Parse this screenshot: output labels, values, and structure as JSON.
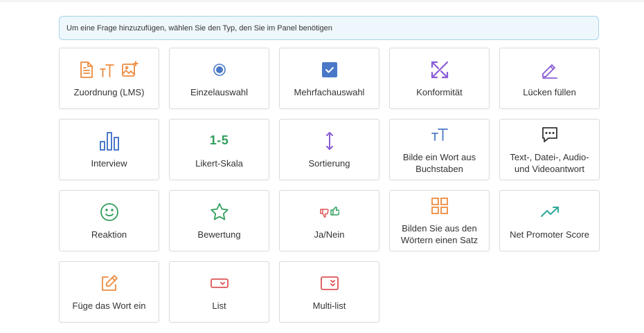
{
  "info": {
    "text": "Um eine Frage hinzuzufügen, wählen Sie den Typ, den Sie im Panel benötigen"
  },
  "colors": {
    "orange": "#ee8a3c",
    "blue": "#4a78c8",
    "purple": "#8a5bd6",
    "green": "#2f9e5a",
    "red": "#dd5454",
    "teal": "#2ea89a",
    "dark": "#333333"
  },
  "question_types": [
    {
      "label": "Zuordnung (LMS)",
      "icon": "document-text-image-icons"
    },
    {
      "label": "Einzelauswahl",
      "icon": "radio-icon"
    },
    {
      "label": "Mehrfachauswahl",
      "icon": "checkbox-icon"
    },
    {
      "label": "Konformität",
      "icon": "arrows-diagonal-icon"
    },
    {
      "label": "Lücken füllen",
      "icon": "pencil-icon"
    },
    {
      "label": "Interview",
      "icon": "bar-chart-icon"
    },
    {
      "label": "Likert-Skala",
      "icon": "likert-scale-icon",
      "icon_text": "1-5"
    },
    {
      "label": "Sortierung",
      "icon": "sort-arrows-icon"
    },
    {
      "label": "Bilde ein Wort aus Buchstaben",
      "icon": "text-size-icon"
    },
    {
      "label": "Text-, Datei-, Audio- und Videoantwort",
      "icon": "chat-bubble-icon"
    },
    {
      "label": "Reaktion",
      "icon": "smiley-icon"
    },
    {
      "label": "Bewertung",
      "icon": "star-icon"
    },
    {
      "label": "Ja/Nein",
      "icon": "thumbs-icon"
    },
    {
      "label": "Bilden Sie aus den Wörtern einen Satz",
      "icon": "grid-icon"
    },
    {
      "label": "Net Promoter Score",
      "icon": "trend-up-icon"
    },
    {
      "label": "Füge das Wort ein",
      "icon": "edit-box-icon"
    },
    {
      "label": "List",
      "icon": "dropdown-icon"
    },
    {
      "label": "Multi-list",
      "icon": "multi-dropdown-icon"
    }
  ]
}
